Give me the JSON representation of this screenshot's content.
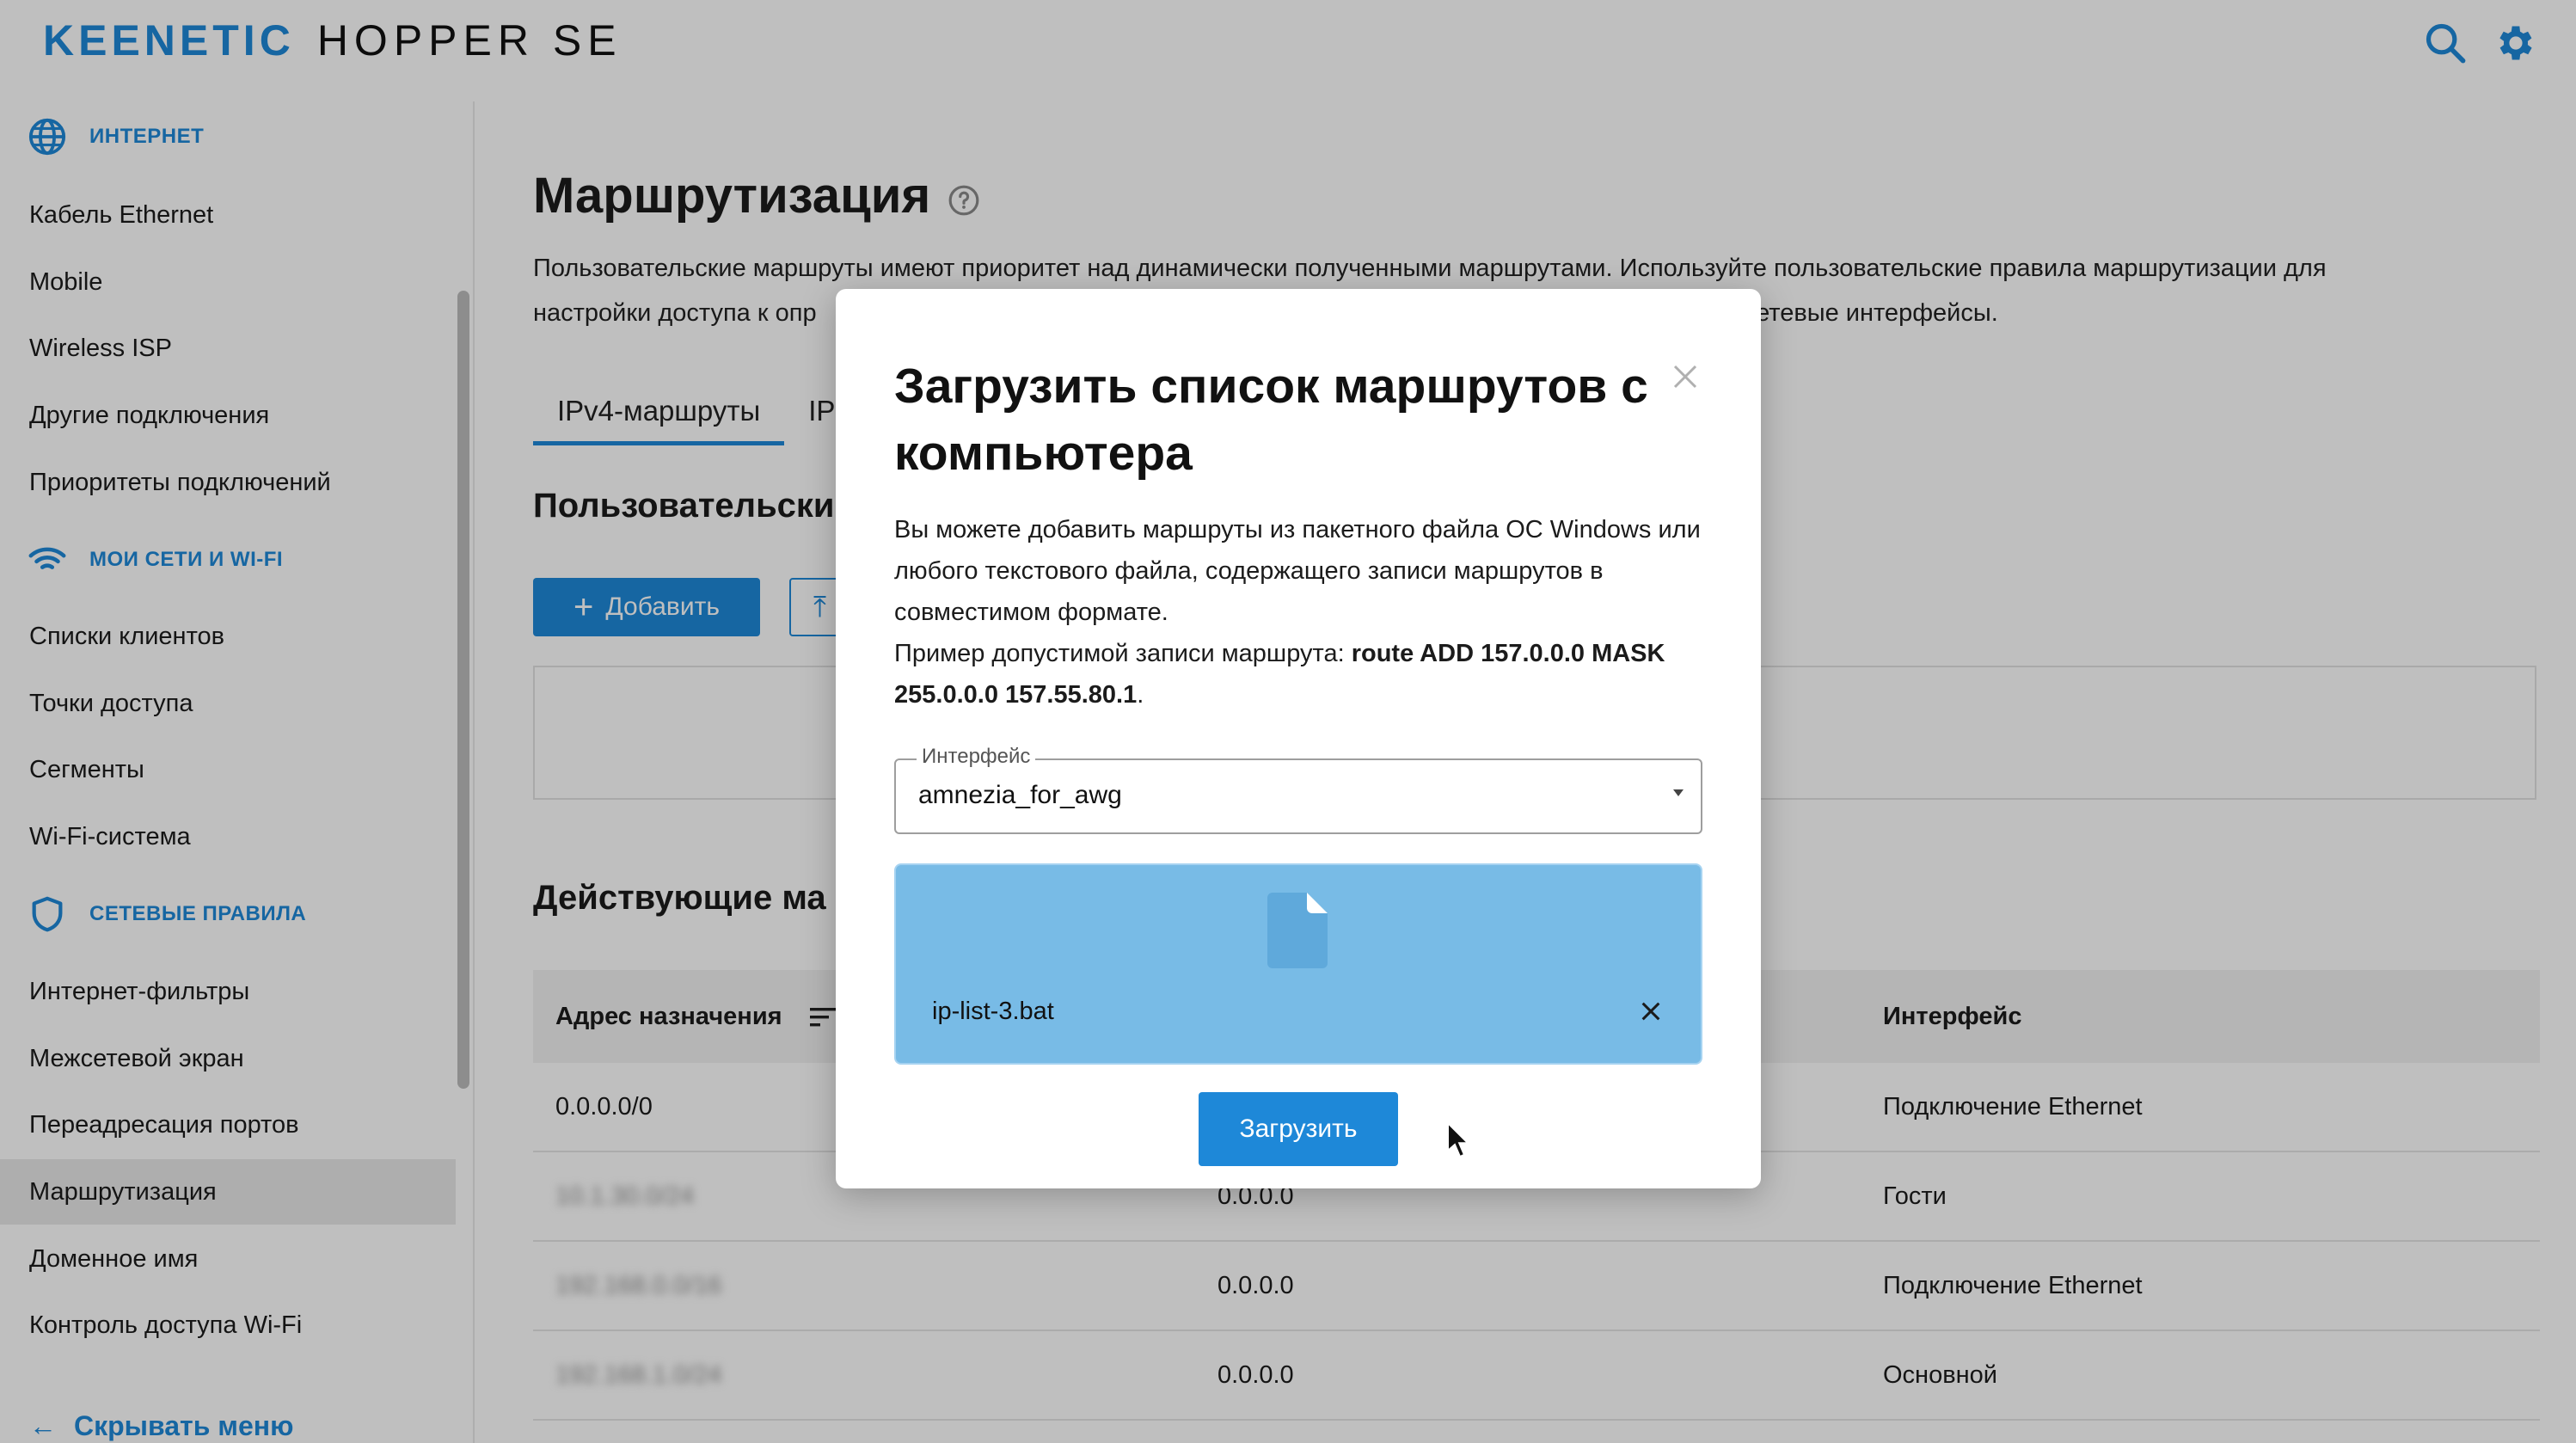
{
  "header": {
    "brand": "KEENETIC",
    "model": "HOPPER SE",
    "search_icon": "search-icon",
    "settings_icon": "gear-icon",
    "accent_color": "#1e88d8"
  },
  "sidebar": {
    "sections": [
      {
        "icon": "globe-icon",
        "label": "ИНТЕРНЕТ"
      },
      {
        "icon": "wifi-icon",
        "label": "МОИ СЕТИ И WI-FI"
      },
      {
        "icon": "shield-icon",
        "label": "СЕТЕВЫЕ ПРАВИЛА"
      }
    ],
    "items": [
      "Кабель Ethernet",
      "Mobile",
      "Wireless ISP",
      "Другие подключения",
      "Приоритеты подключений",
      "Списки клиентов",
      "Точки доступа",
      "Сегменты",
      "Wi-Fi-система",
      "Интернет-фильтры",
      "Межсетевой экран",
      "Переадресация портов",
      "Маршрутизация",
      "Доменное имя",
      "Контроль доступа Wi-Fi"
    ],
    "active_item": "Маршрутизация",
    "hide_menu": "Скрывать меню"
  },
  "main": {
    "title": "Маршрутизация",
    "description_line1": "Пользовательские маршруты имеют приоритет над динамически полученными маршрутами. Используйте пользовательские правила маршрутизации для",
    "description_line2": "настройки доступа к опр",
    "description_line2_end": "сетевые интерфейсы.",
    "tabs": [
      "IPv4-маршруты",
      "IP"
    ],
    "user_routes_heading": "Пользовательски",
    "add_button": "Добавить",
    "active_routes_heading": "Действующие ма",
    "table": {
      "headers": [
        "Адрес назначения",
        "Интерфейс"
      ],
      "rows": [
        {
          "dest": "0.0.0.0/0",
          "gateway": "",
          "iface": "Подключение Ethernet"
        },
        {
          "dest": "10.1.30.0/24",
          "gateway": "0.0.0.0",
          "iface": "Гости"
        },
        {
          "dest": "192.168.0.0/16",
          "gateway": "0.0.0.0",
          "iface": "Подключение Ethernet"
        },
        {
          "dest": "192.168.1.0/24",
          "gateway": "0.0.0.0",
          "iface": "Основной"
        }
      ]
    }
  },
  "modal": {
    "title": "Загрузить список маршрутов с компьютера",
    "body_line1": "Вы можете добавить маршруты из пакетного файла ОС Windows или любого текстового файла, содержащего записи маршрутов в совместимом формате.",
    "example_prefix": "Пример допустимой записи маршрута: ",
    "example_route": "route ADD 157.0.0.0 MASK 255.0.0.0 157.55.80.1",
    "example_suffix": ".",
    "interface_label": "Интерфейс",
    "interface_value": "amnezia_for_awg",
    "file_name": "ip-list-3.bat",
    "submit": "Загрузить",
    "close_icon": "close-icon"
  }
}
